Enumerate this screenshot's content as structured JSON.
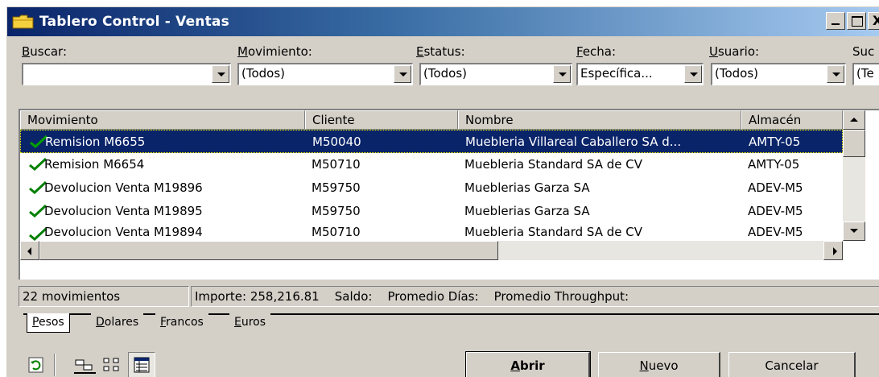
{
  "window": {
    "title": "Tablero Control - Ventas",
    "caption_buttons": {
      "minimize": "_",
      "maximize": "□",
      "close": "X"
    }
  },
  "filters": [
    {
      "label_accel": "B",
      "label_rest": "uscar:",
      "value": ""
    },
    {
      "label_accel": "M",
      "label_rest": "ovimiento:",
      "value": "(Todos)"
    },
    {
      "label_accel": "E",
      "label_rest": "status:",
      "value": "(Todos)"
    },
    {
      "label_accel": "F",
      "label_rest": "echa:",
      "value": "Específica..."
    },
    {
      "label_accel": "U",
      "label_rest": "suario:",
      "value": "(Todos)"
    },
    {
      "label_accel": "",
      "label_rest": "Suc",
      "value": "(Te"
    }
  ],
  "grid": {
    "columns": [
      "Movimiento",
      "Cliente",
      "Nombre",
      "Almacén"
    ],
    "rows": [
      {
        "movimiento": "Remision M6655",
        "cliente": "M50040",
        "nombre": "Muebleria Villareal Caballero SA d...",
        "almacen": "AMTY-05",
        "selected": true
      },
      {
        "movimiento": "Remision M6654",
        "cliente": "M50710",
        "nombre": "Muebleria Standard SA de CV",
        "almacen": "AMTY-05"
      },
      {
        "movimiento": "Devolucion Venta M19896",
        "cliente": "M59750",
        "nombre": "Mueblerias Garza SA",
        "almacen": "ADEV-M5"
      },
      {
        "movimiento": "Devolucion Venta M19895",
        "cliente": "M59750",
        "nombre": "Mueblerias Garza SA",
        "almacen": "ADEV-M5"
      },
      {
        "movimiento": "Devolucion Venta M19894",
        "cliente": "M50710",
        "nombre": "Muebleria Standard SA de CV",
        "almacen": "ADEV-M5"
      }
    ]
  },
  "status": {
    "count": "22 movimientos",
    "summary": "Importe: 258,216.81    Saldo:    Promedio Días:    Promedio Throughput:"
  },
  "tabs": [
    {
      "accel": "P",
      "rest": "esos"
    },
    {
      "accel": "D",
      "rest": "olares"
    },
    {
      "accel": "F",
      "rest": "rancos"
    },
    {
      "accel": "E",
      "rest": "uros"
    }
  ],
  "toolbar": {
    "icons": [
      "refresh-icon",
      "preview-icon",
      "tree-view-icon",
      "details-view-icon"
    ]
  },
  "buttons": {
    "abrir": {
      "accel": "A",
      "rest": "brir"
    },
    "nuevo": {
      "accel": "N",
      "rest": "uevo"
    },
    "cancelar": "Cancelar"
  },
  "colors": {
    "title_gradient_start": "#0a246a",
    "title_gradient_end": "#a6caf0",
    "selection": "#0a246a",
    "face": "#d4d0c8",
    "check": "#008000"
  }
}
